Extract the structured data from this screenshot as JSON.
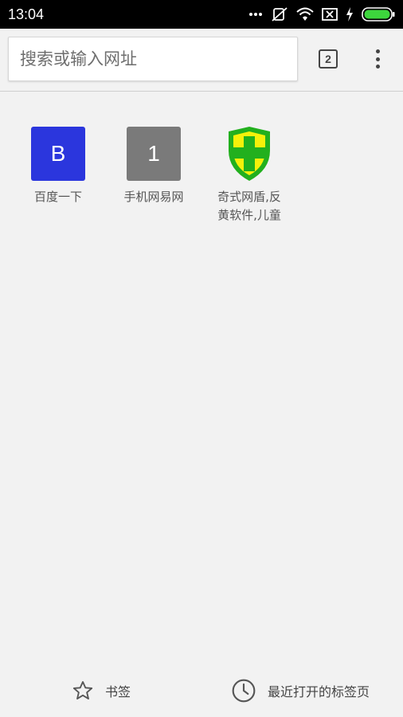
{
  "status_bar": {
    "time": "13:04",
    "icons": [
      "more-dots-icon",
      "mute-icon",
      "wifi-icon",
      "sim-off-icon",
      "charging-icon",
      "battery-icon"
    ]
  },
  "toolbar": {
    "url_placeholder": "搜索或输入网址",
    "tab_count": "2",
    "menu_icon": "more-vert-icon"
  },
  "tiles": [
    {
      "icon_text": "B",
      "label": "百度一下",
      "color": "#2b36dd"
    },
    {
      "icon_text": "1",
      "label": "手机网易网",
      "color": "#7a7a7a"
    },
    {
      "icon_text": "",
      "label": "奇式网盾,反\n黄软件,儿童",
      "icon": "green-shield-cross-icon"
    }
  ],
  "bottom_bar": {
    "bookmarks": "书签",
    "recent_tabs": "最近打开的标签页"
  },
  "colors": {
    "background": "#f2f2f2",
    "shield_green": "#22b01e",
    "shield_yellow": "#f5f10a"
  }
}
